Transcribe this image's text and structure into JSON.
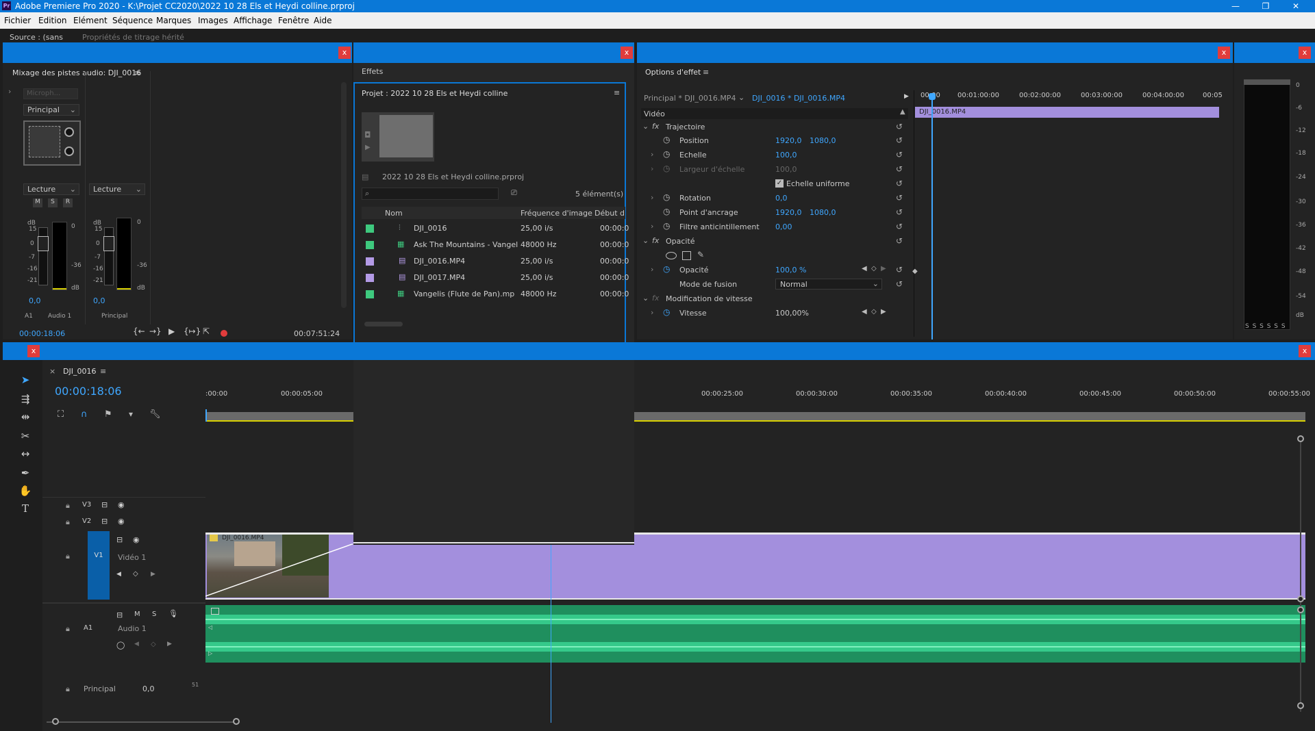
{
  "titlebar": {
    "app_icon": "Pr",
    "title": "Adobe Premiere Pro 2020 - K:\\Projet CC2020\\2022 10 28 Els et Heydi colline.prproj",
    "minimize": "—",
    "maximize": "❐",
    "close": "✕"
  },
  "menu": [
    "Fichier",
    "Edition",
    "Elément",
    "Séquence",
    "Marques",
    "Images",
    "Affichage",
    "Fenêtre",
    "Aide"
  ],
  "source_bar": {
    "source_tab": "Source : (sans",
    "titling_tab": "Propriétés de titrage hérité"
  },
  "audio_mixer": {
    "title": "Mixage des pistes audio: DJI_0016",
    "dropdown": "Microph...",
    "principal": "Principal",
    "mode_left": "Lecture",
    "mode_right": "Lecture",
    "msr": [
      "M",
      "S",
      "R"
    ],
    "db_label": "dB",
    "scale_left": [
      "15",
      "-",
      "0",
      "-",
      "-7",
      "-",
      "-16",
      "-",
      "-21"
    ],
    "scale_right": [
      "0",
      "-36",
      "dB"
    ],
    "value_left": "0,0",
    "value_right": "0,0",
    "track_a1": "A1",
    "track_audio1": "Audio 1",
    "track_principal": "Principal",
    "time_left": "00:00:18:06",
    "time_right": "00:07:51:24"
  },
  "effects_panel": {
    "title": "Effets"
  },
  "project_panel": {
    "title": "Projet : 2022 10 28 Els et Heydi colline",
    "project_file": "2022 10 28 Els et Heydi colline.prproj",
    "search_placeholder": "",
    "count": "5 élément(s)",
    "columns": [
      "Nom",
      "Fréquence d'image",
      "Début d"
    ],
    "items": [
      {
        "color": "#3ec97e",
        "name": "DJI_0016",
        "rate": "25,00 i/s",
        "start": "00:00:0"
      },
      {
        "color": "#3ec97e",
        "name": "Ask The Mountains - Vangel",
        "rate": "48000  Hz",
        "start": "00:00:0"
      },
      {
        "color": "#b39ae6",
        "name": "DJI_0016.MP4",
        "rate": "25,00 i/s",
        "start": "00:00:0"
      },
      {
        "color": "#b39ae6",
        "name": "DJI_0017.MP4",
        "rate": "25,00 i/s",
        "start": "00:00:0"
      },
      {
        "color": "#3ec97e",
        "name": "Vangelis (Flute de Pan).mp",
        "rate": "48000  Hz",
        "start": "00:00:0"
      }
    ]
  },
  "effect_options": {
    "title": "Options d'effet",
    "source_label": "Principal * DJI_0016.MP4",
    "clip_label": "DJI_0016 * DJI_0016.MP4",
    "video_label": "Vidéo",
    "ruler": [
      "00:00",
      "00:01:00:00",
      "00:02:00:00",
      "00:03:00:00",
      "00:04:00:00",
      "00:05"
    ],
    "clip_bar": "DJI_0016.MP4",
    "trajectoire": "Trajectoire",
    "position_label": "Position",
    "position_x": "1920,0",
    "position_y": "1080,0",
    "echelle_label": "Echelle",
    "echelle_val": "100,0",
    "largeur_label": "Largeur d'échelle",
    "largeur_val": "100,0",
    "uniforme_label": "Echelle uniforme",
    "rotation_label": "Rotation",
    "rotation_val": "0,0",
    "ancrage_label": "Point d'ancrage",
    "ancrage_x": "1920,0",
    "ancrage_y": "1080,0",
    "filtre_label": "Filtre anticintillement",
    "filtre_val": "0,00",
    "opacite_group": "Opacité",
    "opacite_label": "Opacité",
    "opacite_val": "100,0 %",
    "fusion_label": "Mode de fusion",
    "fusion_val": "Normal",
    "vitesse_group": "Modification de vitesse",
    "vitesse_label": "Vitesse",
    "vitesse_val": "100,00%"
  },
  "meter_panel": {
    "scale": [
      "0",
      "-6",
      "-12",
      "-18",
      "-24",
      "-30",
      "-36",
      "-42",
      "-48",
      "-54",
      "dB"
    ],
    "solo": "S S S S S S"
  },
  "timeline": {
    "sequence_name": "DJI_0016",
    "timecode": "00:00:18:06",
    "ruler": [
      ":00:00",
      "00:00:05:00",
      "00:00:25:00",
      "00:00:30:00",
      "00:00:35:00",
      "00:00:40:00",
      "00:00:45:00",
      "00:00:50:00",
      "00:00:55:00"
    ],
    "track_v3": "V3",
    "track_v2": "V2",
    "track_v1": "V1",
    "video1": "Vidéo 1",
    "track_a1": "A1",
    "audio1": "Audio 1",
    "msr_m": "M",
    "msr_s": "S",
    "principal": "Principal",
    "principal_val": "0,0",
    "principal_num": "51",
    "clip_name": "DJI_0016.MP4"
  },
  "colors": {
    "accent": "#0a78d7",
    "clip_video": "#a38fdd",
    "clip_audio": "#1f8f5e",
    "playhead": "#3fa7ff"
  }
}
